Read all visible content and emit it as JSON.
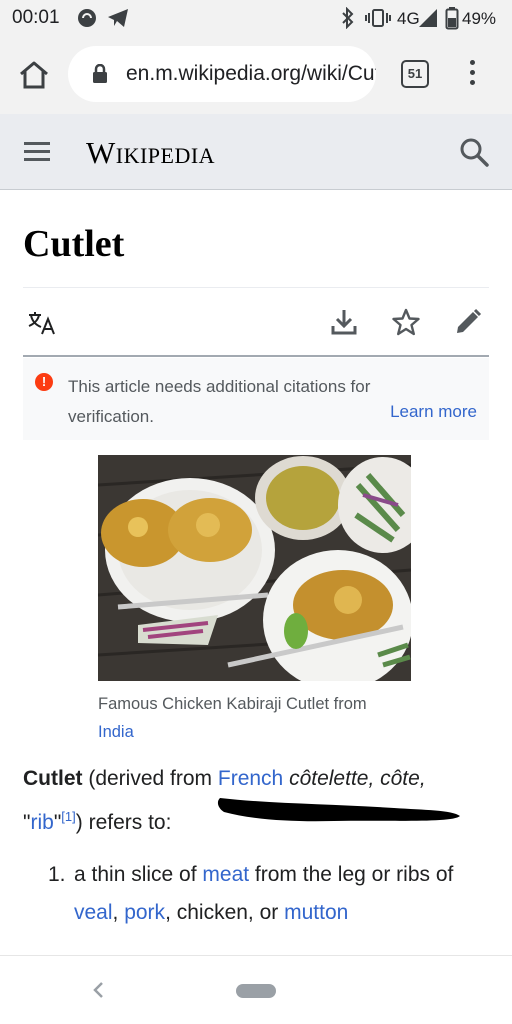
{
  "status_bar": {
    "time": "00:01",
    "network": "4G",
    "battery": "49%",
    "icons": [
      "whatsapp-icon",
      "telegram-icon",
      "bluetooth-icon",
      "vibrate-icon",
      "signal-icon",
      "battery-icon"
    ]
  },
  "browser": {
    "url": "en.m.wikipedia.org/wiki/Cutlet",
    "tab_count": "51",
    "icons": [
      "home-icon",
      "lock-icon",
      "more-vert-icon"
    ]
  },
  "wiki_header": {
    "logo": "Wikipedia",
    "icons": [
      "menu-icon",
      "search-icon"
    ]
  },
  "article": {
    "title": "Cutlet",
    "actions": [
      "language-icon",
      "download-icon",
      "star-icon",
      "edit-icon"
    ],
    "notice": {
      "text": "This article needs additional citations for verification.",
      "link": "Learn more",
      "color": "#fc3c12"
    },
    "figure": {
      "caption_text": "Famous Chicken Kabiraji Cutlet from",
      "caption_link": "India"
    },
    "lead": {
      "term": "Cutlet",
      "derived_text": " (derived from ",
      "french_link": "French",
      "french_words": " côtelette, côte,",
      "quote_open": "\"",
      "rib_link": "rib",
      "quote_close": "\"",
      "citation": "[1]",
      "tail": ") refers to:"
    },
    "list_items": [
      {
        "number": "1.",
        "text_a": "a thin slice of ",
        "link_meat": "meat",
        "text_b": " from the leg or ribs of ",
        "link_veal": "veal",
        "comma1": ", ",
        "link_pork": "pork",
        "text_c": ", chicken, or ",
        "link_mutton": "mutton"
      }
    ],
    "link_color": "#3366cc"
  },
  "nav_bar": {
    "icons": [
      "back-icon",
      "home-pill"
    ]
  }
}
